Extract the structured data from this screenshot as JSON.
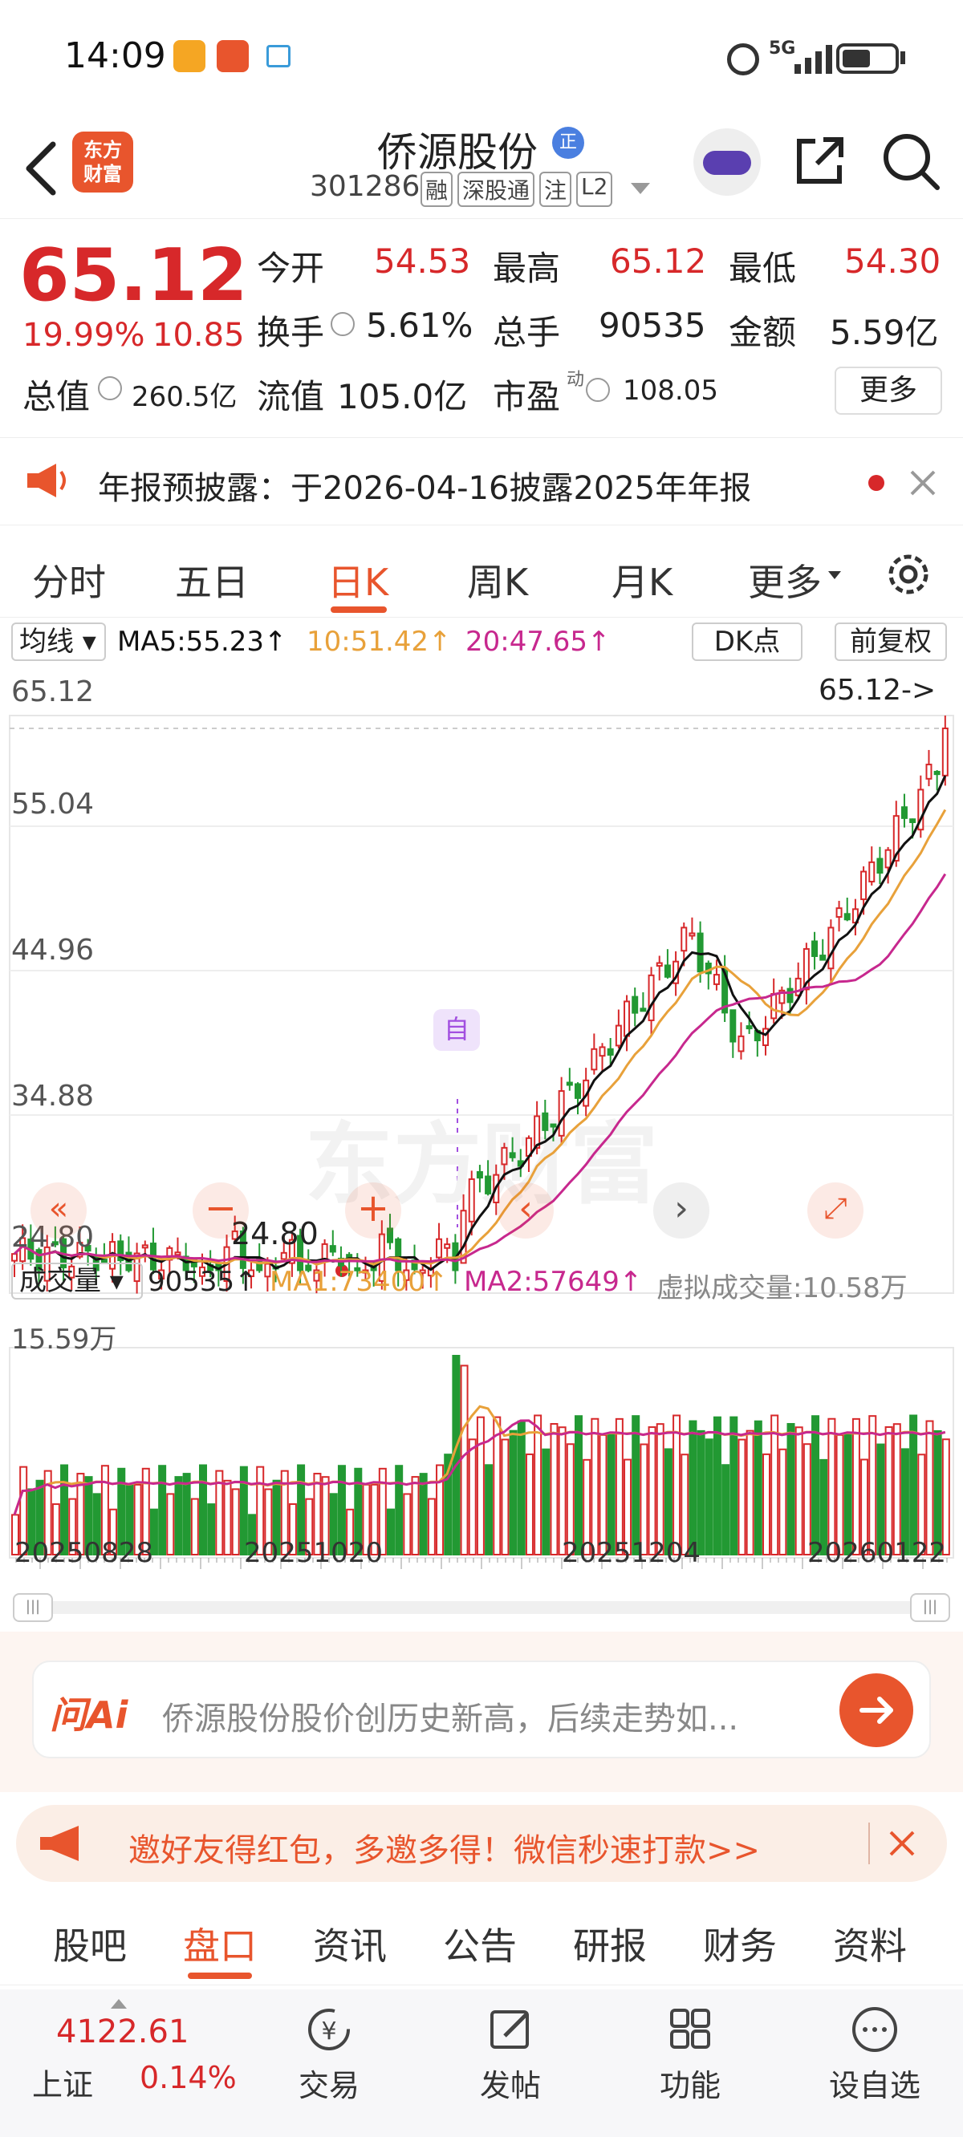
{
  "status": {
    "time": "14:09",
    "signal": "5G"
  },
  "nav": {
    "title": "侨源股份",
    "code": "301286",
    "tags": [
      "融",
      "深股通",
      "注",
      "L2"
    ],
    "logo": "东方\n财富",
    "badge": "正"
  },
  "quote": {
    "price": "65.12",
    "pct": "19.99%",
    "chg": "10.85",
    "fields": [
      {
        "label": "今开",
        "value": "54.53"
      },
      {
        "label": "最高",
        "value": "65.12"
      },
      {
        "label": "最低",
        "value": "54.30"
      },
      {
        "label": "换手",
        "value": "5.61%"
      },
      {
        "label": "总手",
        "value": "90535"
      },
      {
        "label": "金额",
        "value": "5.59亿"
      },
      {
        "label": "总值",
        "value": "260.5亿"
      },
      {
        "label": "流值",
        "value": "105.0亿"
      },
      {
        "label": "市盈",
        "value": "108.05"
      }
    ],
    "pe_sup": "动",
    "more": "更多"
  },
  "notice": {
    "text": "年报预披露：于2026-04-16披露2025年年报"
  },
  "ktabs": [
    "分时",
    "五日",
    "日K",
    "周K",
    "月K",
    "更多"
  ],
  "ma": {
    "label": "均线",
    "ma5": "MA5:55.23↑",
    "ma10": "10:51.42↑",
    "ma20": "20:47.65↑",
    "dk": "DK点",
    "fq": "前复权"
  },
  "price_axis": [
    "65.12",
    "55.04",
    "44.96",
    "34.88",
    "24.80"
  ],
  "marks": {
    "last": "65.12->",
    "low": "24.80",
    "self": "自"
  },
  "vol": {
    "label": "成交量",
    "v": "90535↑",
    "ma1": "MA1:73400↑",
    "ma2": "MA2:57649↑",
    "virtual": "虚拟成交量:10.58万",
    "max": "15.59万"
  },
  "dates": [
    "20250828",
    "20251020",
    "20251204",
    "20260122"
  ],
  "ask": {
    "logo": "问Ai",
    "text": "侨源股份股价创历史新高，后续走势如..."
  },
  "invite": {
    "text": "邀好友得红包，多邀多得！微信秒速打款>>"
  },
  "btabs": [
    "股吧",
    "盘口",
    "资讯",
    "公告",
    "研报",
    "财务",
    "资料"
  ],
  "dock": {
    "index": "4122.61",
    "index_name": "上证",
    "index_pct": "0.14%",
    "items": [
      "交易",
      "发帖",
      "功能",
      "设自选"
    ]
  },
  "colors": {
    "up": "#d7282a",
    "down": "#229933",
    "ma5": "#111111",
    "ma10": "#e8a13a",
    "ma20": "#c7288e",
    "accent": "#e8552d"
  },
  "chart_data": {
    "type": "candlestick",
    "ylim": [
      24.8,
      65.12
    ],
    "last": 65.12,
    "low": 24.8,
    "vol_max": "15.59万",
    "x_ticks": [
      "20250828",
      "20251020",
      "20251204",
      "20260122"
    ]
  }
}
